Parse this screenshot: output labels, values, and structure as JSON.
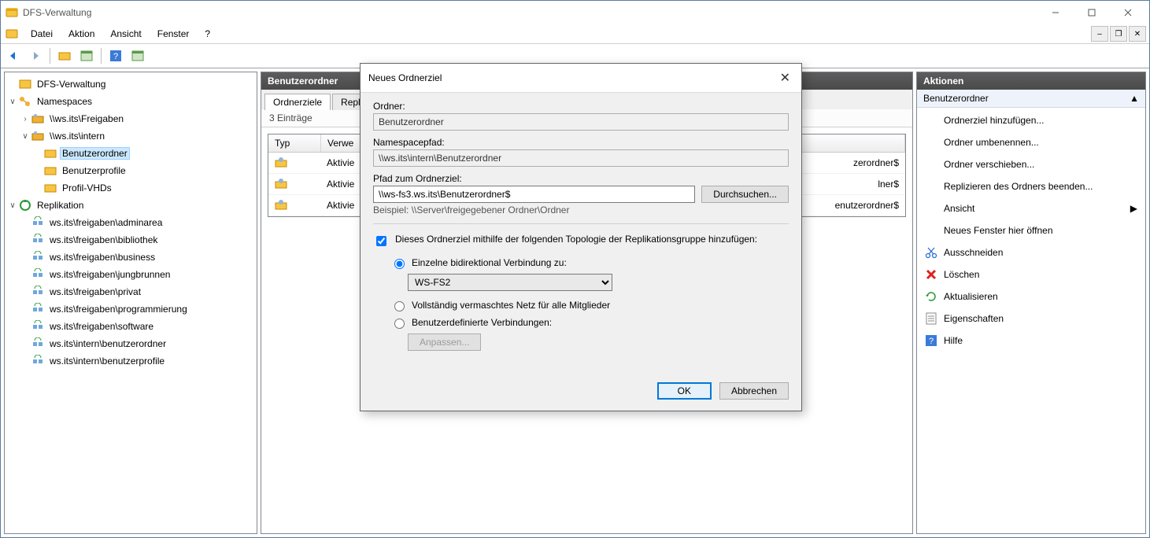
{
  "window": {
    "title": "DFS-Verwaltung"
  },
  "menu": {
    "file": "Datei",
    "action": "Aktion",
    "view": "Ansicht",
    "window": "Fenster",
    "help": "?"
  },
  "tree": {
    "root": "DFS-Verwaltung",
    "namespaces": "Namespaces",
    "ns": [
      "\\\\ws.its\\Freigaben",
      "\\\\ws.its\\intern"
    ],
    "intern_children": [
      "Benutzerordner",
      "Benutzerprofile",
      "Profil-VHDs"
    ],
    "replication": "Replikation",
    "repl": [
      "ws.its\\freigaben\\adminarea",
      "ws.its\\freigaben\\bibliothek",
      "ws.its\\freigaben\\business",
      "ws.its\\freigaben\\jungbrunnen",
      "ws.its\\freigaben\\privat",
      "ws.its\\freigaben\\programmierung",
      "ws.its\\freigaben\\software",
      "ws.its\\intern\\benutzerordner",
      "ws.its\\intern\\benutzerprofile"
    ]
  },
  "center": {
    "heading": "Benutzerordner",
    "tabs": {
      "t1": "Ordnerziele",
      "t2": "Repl"
    },
    "count": "3 Einträge",
    "cols": {
      "c1": "Typ",
      "c2": "Verwe"
    },
    "rows": [
      {
        "status": "Aktivie",
        "path": "zerordner$"
      },
      {
        "status": "Aktivie",
        "path": "lner$"
      },
      {
        "status": "Aktivie",
        "path": "enutzerordner$"
      }
    ]
  },
  "actions": {
    "heading": "Aktionen",
    "group": "Benutzerordner",
    "items": [
      "Ordnerziel hinzufügen...",
      "Ordner umbenennen...",
      "Ordner verschieben...",
      "Replizieren des Ordners beenden...",
      "Ansicht",
      "Neues Fenster hier öffnen",
      "Ausschneiden",
      "Löschen",
      "Aktualisieren",
      "Eigenschaften",
      "Hilfe"
    ]
  },
  "dialog": {
    "title": "Neues Ordnerziel",
    "folder_label": "Ordner:",
    "folder_value": "Benutzerordner",
    "nspath_label": "Namespacepfad:",
    "nspath_value": "\\\\ws.its\\intern\\Benutzerordner",
    "target_label": "Pfad zum Ordnerziel:",
    "target_value": "\\\\ws-fs3.ws.its\\Benutzerordner$",
    "browse": "Durchsuchen...",
    "example": "Beispiel: \\\\Server\\freigegebener Ordner\\Ordner",
    "add_topology": "Dieses Ordnerziel mithilfe der folgenden Topologie der Replikationsgruppe hinzufügen:",
    "r1": "Einzelne bidirektional Verbindung zu:",
    "server": "WS-FS2",
    "r2": "Vollständig vermaschtes Netz für alle Mitglieder",
    "r3": "Benutzerdefinierte Verbindungen:",
    "custom_btn": "Anpassen...",
    "ok": "OK",
    "cancel": "Abbrechen"
  }
}
